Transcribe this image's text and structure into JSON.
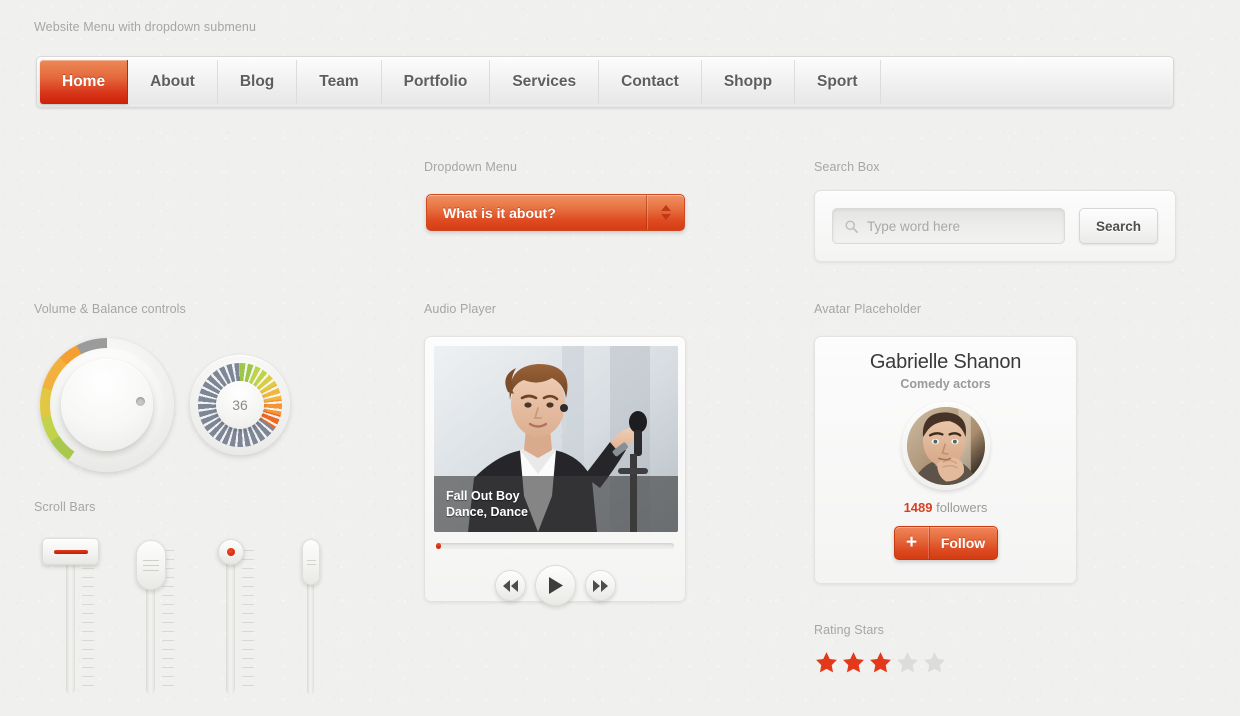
{
  "page": {
    "top_caption": "Website Menu with dropdown submenu"
  },
  "nav": {
    "items": [
      {
        "label": "Home",
        "active": true
      },
      {
        "label": "About",
        "active": false
      },
      {
        "label": "Blog",
        "active": false
      },
      {
        "label": "Team",
        "active": false
      },
      {
        "label": "Portfolio",
        "active": false
      },
      {
        "label": "Services",
        "active": false
      },
      {
        "label": "Contact",
        "active": false
      },
      {
        "label": "Shopp",
        "active": false
      },
      {
        "label": "Sport",
        "active": false
      }
    ]
  },
  "dropdown": {
    "label": "Dropdown Menu",
    "selected": "What is it about?"
  },
  "search": {
    "label": "Search Box",
    "placeholder": "Type word here",
    "value": "",
    "button_label": "Search"
  },
  "knobs": {
    "label": "Volume & Balance controls",
    "balance_value": "36"
  },
  "sliders": {
    "label": "Scroll Bars"
  },
  "audio": {
    "label": "Audio Player",
    "artist": "Fall Out Boy",
    "track": "Dance, Dance",
    "progress_percent": 2
  },
  "avatar": {
    "label": "Avatar Placeholder",
    "name": "Gabrielle Shanon",
    "role": "Comedy actors",
    "followers_count": "1489",
    "followers_word": "followers",
    "follow_label": "Follow",
    "plus_label": "+"
  },
  "rating": {
    "label": "Rating Stars",
    "filled": 3,
    "total": 5
  },
  "colors": {
    "accent_red": "#d8401e",
    "accent_orange": "#e8804d",
    "star_filled": "#e3381a",
    "star_empty": "#dcdcda",
    "background": "#f0f0ee"
  }
}
